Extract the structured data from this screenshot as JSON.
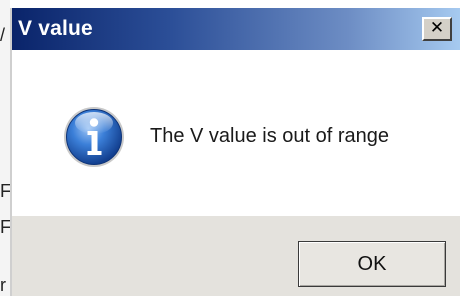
{
  "background": {
    "fragments": [
      "/",
      "F",
      "F",
      "r"
    ]
  },
  "dialog": {
    "title": "V value",
    "close_glyph": "✕",
    "icon": "info-icon",
    "icon_letter": "i",
    "message": "The V value is out of range",
    "ok_label": "OK"
  },
  "colors": {
    "titlebar_start": "#0a246a",
    "titlebar_end": "#a6caf0",
    "footer": "#e4e2dd",
    "icon_blue": "#1f5fbf"
  }
}
